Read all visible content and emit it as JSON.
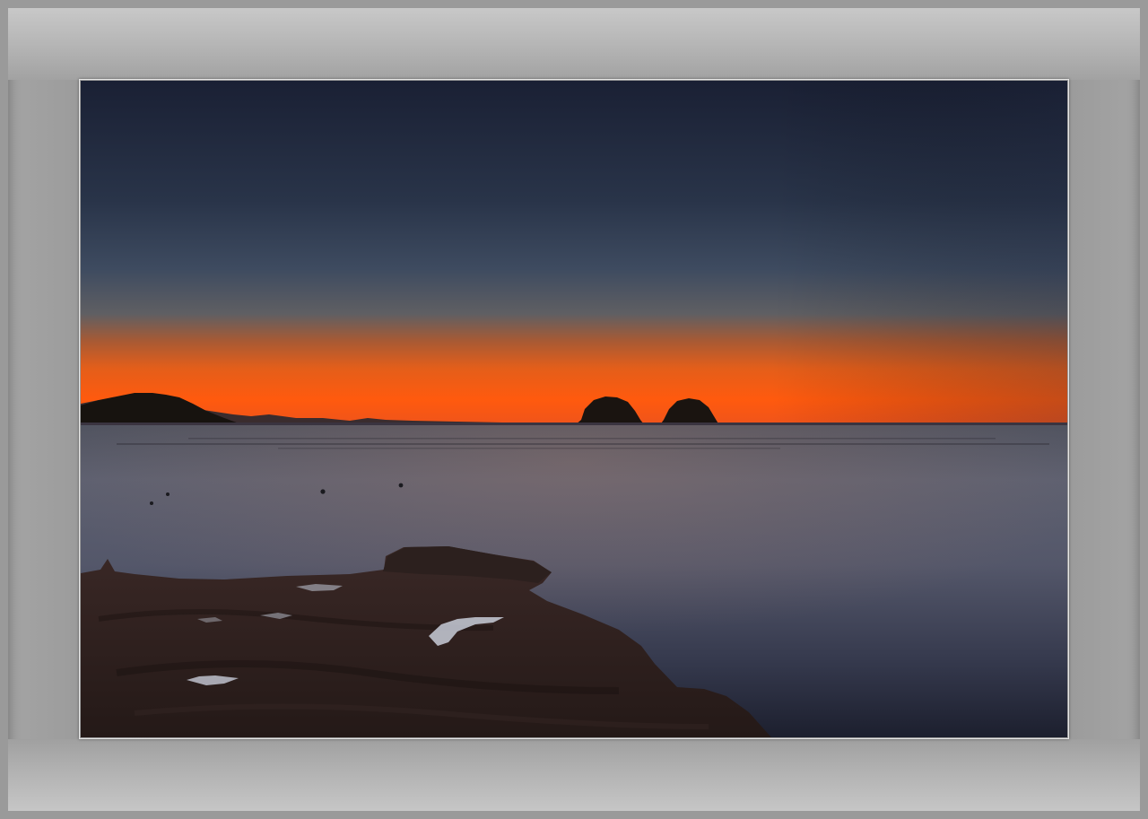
{
  "photo": {
    "subject": "sunset-seascape",
    "colors": {
      "sky_top": "#1a2236",
      "sky_mid": "#3c4a62",
      "horizon_glow": "#ff5a10",
      "horizon_orange": "#e8641c",
      "water": "#5a5e6e",
      "rock": "#2a1e1c",
      "frame_mat": "#9a9a9a"
    }
  }
}
